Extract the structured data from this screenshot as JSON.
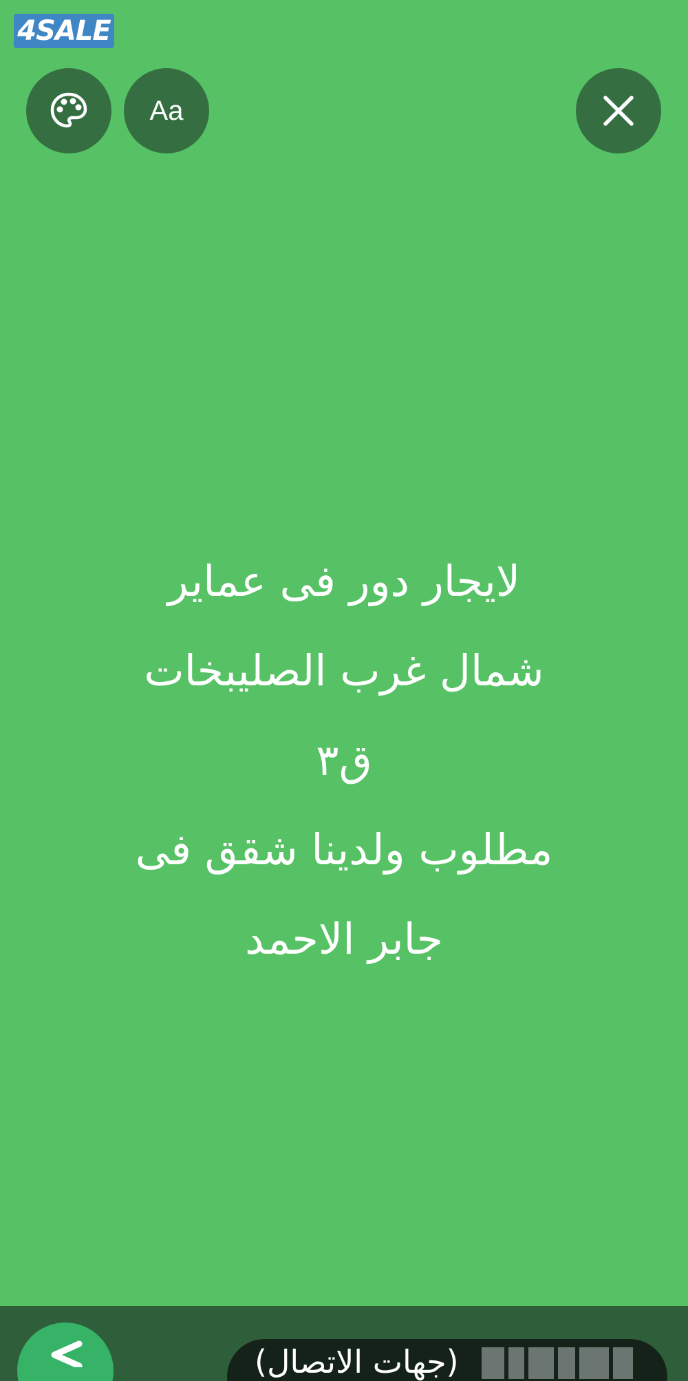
{
  "watermark": {
    "brand": "4SALE"
  },
  "toolbar": {
    "palette_icon": "palette-icon",
    "font_button_label": "Aa",
    "close_icon": "close-icon"
  },
  "story": {
    "background_color": "#57c265",
    "lines": [
      "لايجار دور فى عماير",
      "شمال غرب الصليبخات",
      "ق٣",
      "مطلوب ولدينا شقق فى",
      "جابر الاحمد"
    ]
  },
  "footer": {
    "share_icon": "share-arrow-icon",
    "contact_label": "(جهات الاتصال)"
  }
}
